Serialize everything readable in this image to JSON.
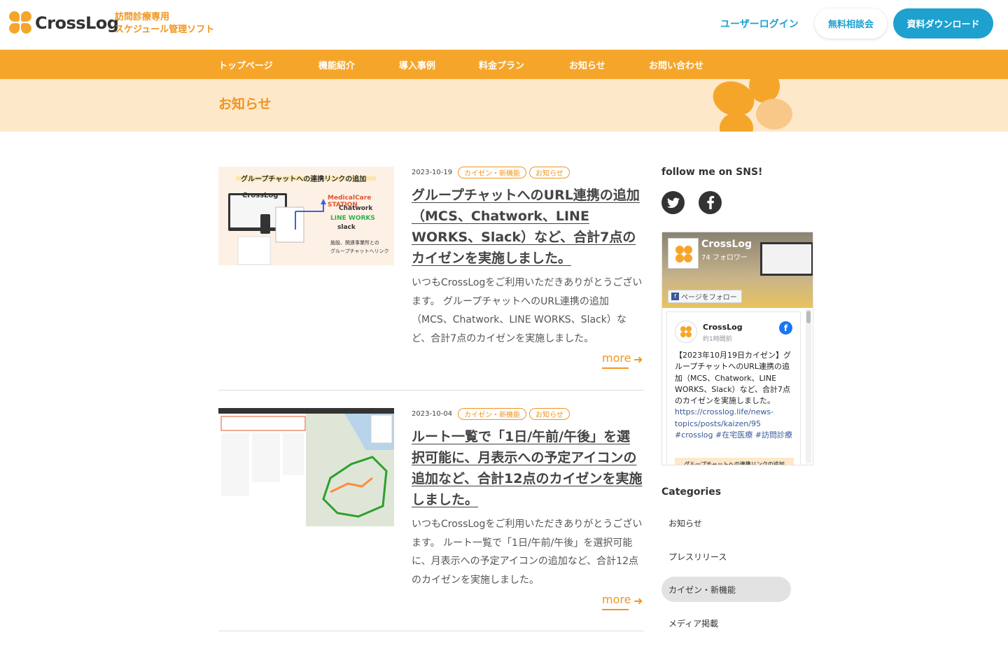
{
  "header": {
    "logo_text": "CrossLog",
    "tagline_1": "訪問診療専用",
    "tagline_2": "スケジュール管理ソフト",
    "login_label": "ユーザーログイン",
    "consult_label": "無料相談会",
    "download_label": "資料ダウンロード"
  },
  "nav": {
    "items": [
      {
        "label": "トップページ"
      },
      {
        "label": "機能紹介"
      },
      {
        "label": "導入事例"
      },
      {
        "label": "料金プラン"
      },
      {
        "label": "お知らせ"
      },
      {
        "label": "お問い合わせ"
      }
    ]
  },
  "banner": {
    "title": "お知らせ"
  },
  "articles": [
    {
      "date": "2023-10-19",
      "tags": [
        "カイゼン・新機能",
        "お知らせ"
      ],
      "title": "グループチャットへのURL連携の追加（MCS、Chatwork、LINE WORKS、Slack）など、合計7点のカイゼンを実施しました。",
      "excerpt": "いつもCrossLogをご利用いただきありがとうございます。 グループチャットへのURL連携の追加（MCS、Chatwork、LINE WORKS、Slack）など、合計7点のカイゼンを実施しました。",
      "more_label": "more",
      "thumb": {
        "heading": "グループチャットへの連携リンクの追加",
        "brand": "CrossLog",
        "services": [
          "MedicalCare STATION",
          "Chatwork",
          "LINE WORKS",
          "slack"
        ],
        "caption_1": "施設、関連事業所との",
        "caption_2": "グループチャットへリンク"
      }
    },
    {
      "date": "2023-10-04",
      "tags": [
        "カイゼン・新機能",
        "お知らせ"
      ],
      "title": "ルート一覧で「1日/午前/午後」を選択可能に、月表示への予定アイコンの追加など、合計12点のカイゼンを実施しました。",
      "excerpt": "いつもCrossLogをご利用いただきありがとうございます。 ルート一覧で「1日/午前/午後」を選択可能に、月表示への予定アイコンの追加など、合計12点のカイゼンを実施しました。",
      "more_label": "more"
    }
  ],
  "sidebar": {
    "sns_title": "follow me on SNS!",
    "fb": {
      "page_name": "CrossLog",
      "followers": "74 フォロワー",
      "follow_label": "ページをフォロー",
      "post_name": "CrossLog",
      "post_time": "約1時間前",
      "post_text": "【2023年10月19日カイゼン】グループチャットへのURL連携の追加（MCS、Chatwork、LINE WORKS、Slack）など、合計7点のカイゼンを実施しました。",
      "post_link": "https://crosslog.life/news-topics/posts/kaizen/95",
      "post_hashtags": "#crosslog #在宅医療 #訪問診療",
      "post_img_text": "グループチャットへの連携リンクの追加"
    },
    "categories_title": "Categories",
    "categories": [
      {
        "label": "お知らせ"
      },
      {
        "label": "プレスリリース"
      },
      {
        "label": "カイゼン・新機能"
      },
      {
        "label": "メディア掲載"
      }
    ]
  },
  "colors": {
    "accent": "#f5a62a",
    "accent_text": "#f0951f",
    "primary_blue": "#1ea1cf",
    "banner_bg": "#fde8c9"
  }
}
